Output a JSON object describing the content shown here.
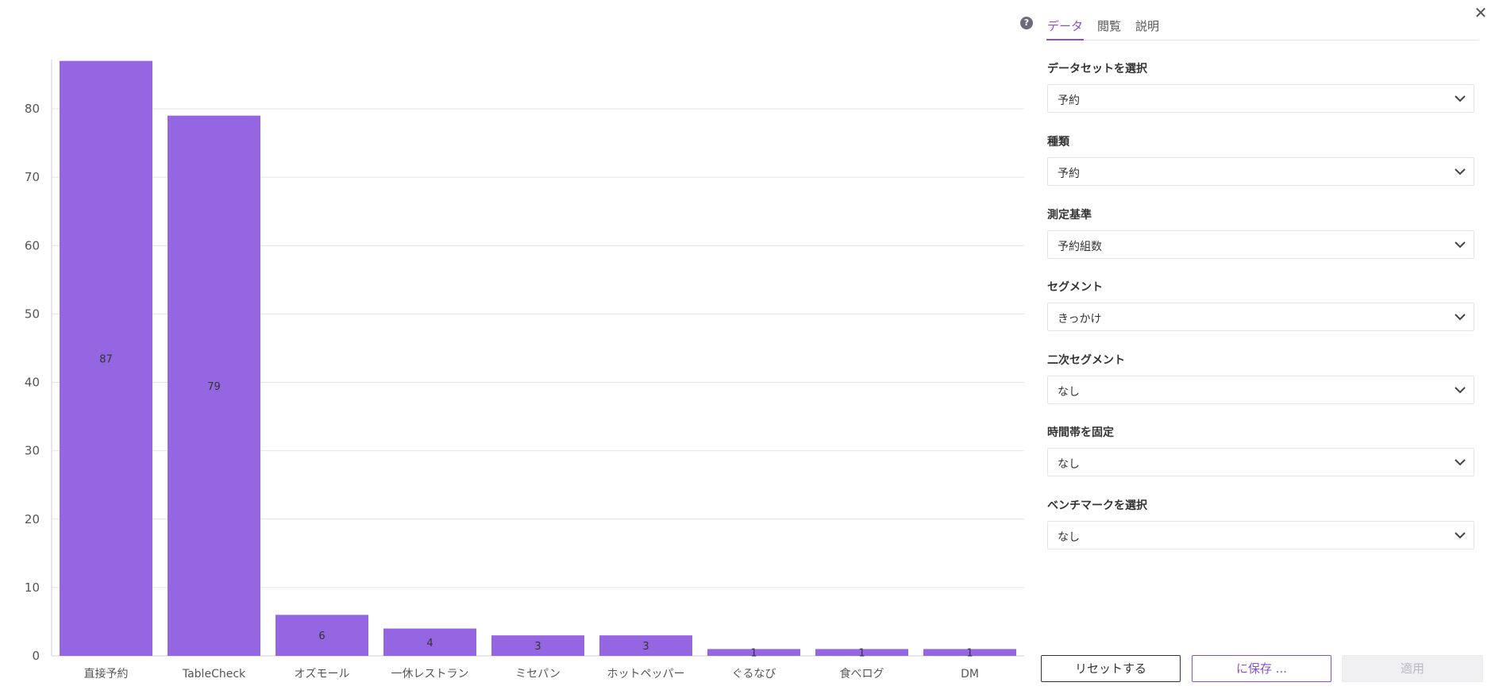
{
  "chart_data": {
    "type": "bar",
    "categories": [
      "直接予約",
      "TableCheck",
      "オズモール",
      "一休レストラン",
      "ミセパン",
      "ホットペッパー",
      "ぐるなび",
      "食べログ",
      "DM"
    ],
    "values": [
      87,
      79,
      6,
      4,
      3,
      3,
      1,
      1,
      1
    ],
    "data_labels": [
      "87",
      "79",
      "6",
      "4",
      "3",
      "3",
      "1",
      "1",
      "1"
    ],
    "yticks": [
      0,
      10,
      20,
      30,
      40,
      50,
      60,
      70,
      80
    ],
    "ylim": [
      0,
      87
    ],
    "grid": true,
    "bar_color": "#9466e2"
  },
  "panel": {
    "help_icon": "question-circle-icon",
    "help_glyph": "?",
    "close_icon": "close-icon",
    "close_glyph": "✕",
    "tabs": [
      {
        "label": "データ",
        "active": true
      },
      {
        "label": "閲覧",
        "active": false
      },
      {
        "label": "説明",
        "active": false
      }
    ],
    "fields": [
      {
        "label": "データセットを選択",
        "value": "予約"
      },
      {
        "label": "種類",
        "value": "予約"
      },
      {
        "label": "測定基準",
        "value": "予約組数"
      },
      {
        "label": "セグメント",
        "value": "きっかけ"
      },
      {
        "label": "二次セグメント",
        "value": "なし"
      },
      {
        "label": "時間帯を固定",
        "value": "なし"
      },
      {
        "label": "ベンチマークを選択",
        "value": "なし"
      }
    ],
    "buttons": {
      "reset": "リセットする",
      "save": "に保存 ...",
      "apply": "適用"
    },
    "accent_color": "#8a4fd6"
  }
}
